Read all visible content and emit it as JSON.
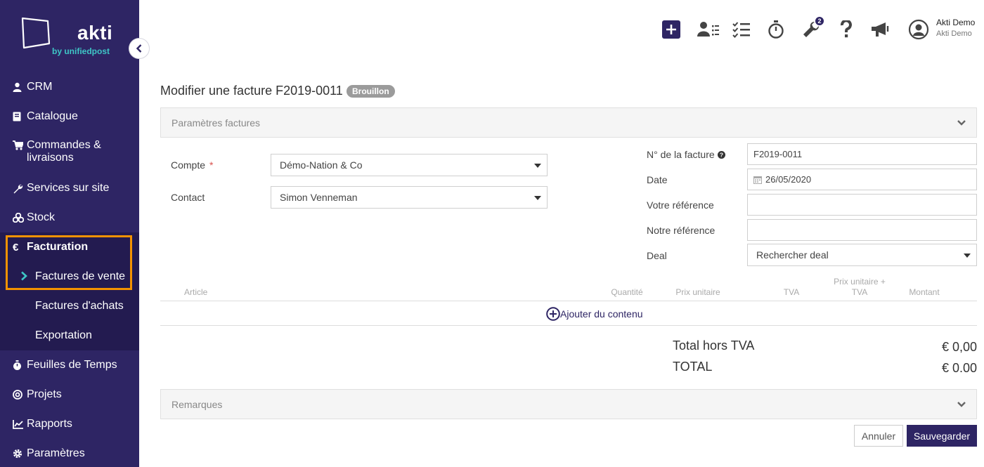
{
  "brand": {
    "name": "akti",
    "tagline": "by unifiedpost",
    "primary_color": "#2e2564",
    "accent_color": "#3ec6c6",
    "highlight_color": "#f39200"
  },
  "sidebar": {
    "items": [
      {
        "label": "CRM",
        "icon": "user-icon"
      },
      {
        "label": "Catalogue",
        "icon": "book-icon"
      },
      {
        "label": "Commandes &",
        "label2": "livraisons",
        "icon": "cart-icon"
      },
      {
        "label": "Services sur site",
        "icon": "wrench-icon"
      },
      {
        "label": "Stock",
        "icon": "boxes-icon"
      },
      {
        "label": "Facturation",
        "icon": "euro-icon"
      },
      {
        "label": "Feuilles de Temps",
        "icon": "stopwatch-icon"
      },
      {
        "label": "Projets",
        "icon": "target-icon"
      },
      {
        "label": "Rapports",
        "icon": "chart-icon"
      },
      {
        "label": "Paramètres",
        "icon": "gear-icon"
      }
    ],
    "facturation_sub": [
      {
        "label": "Factures de vente",
        "active": true
      },
      {
        "label": "Factures d'achats"
      },
      {
        "label": "Exportation"
      }
    ]
  },
  "topbar": {
    "notification_count": "2",
    "user_name": "Akti Demo",
    "user_org": "Akti Demo"
  },
  "page": {
    "title": "Modifier une facture F2019-0011",
    "status": "Brouillon"
  },
  "params_panel": {
    "title": "Paramètres factures"
  },
  "form": {
    "compte_label": "Compte",
    "compte_required": "*",
    "compte_value": "Démo-Nation & Co",
    "contact_label": "Contact",
    "contact_value": "Simon Venneman",
    "invoice_no_label": "N° de la facture",
    "invoice_no_value": "F2019-0011",
    "date_label": "Date",
    "date_value": "26/05/2020",
    "votre_ref_label": "Votre référence",
    "votre_ref_value": "",
    "notre_ref_label": "Notre référence",
    "notre_ref_value": "",
    "deal_label": "Deal",
    "deal_value": "Rechercher deal"
  },
  "table": {
    "headers": {
      "article": "Article",
      "quantite": "Quantité",
      "prix_unitaire": "Prix unitaire",
      "tva": "TVA",
      "prix_tva_line1": "Prix unitaire +",
      "prix_tva_line2": "TVA",
      "montant": "Montant"
    },
    "add_content": "Ajouter du contenu"
  },
  "totals": {
    "ht_label": "Total hors TVA",
    "ht_value": "€ 0,00",
    "total_label": "TOTAL",
    "total_value": "€ 0.00"
  },
  "remarks_panel": {
    "title": "Remarques"
  },
  "actions": {
    "cancel": "Annuler",
    "save": "Sauvegarder"
  }
}
